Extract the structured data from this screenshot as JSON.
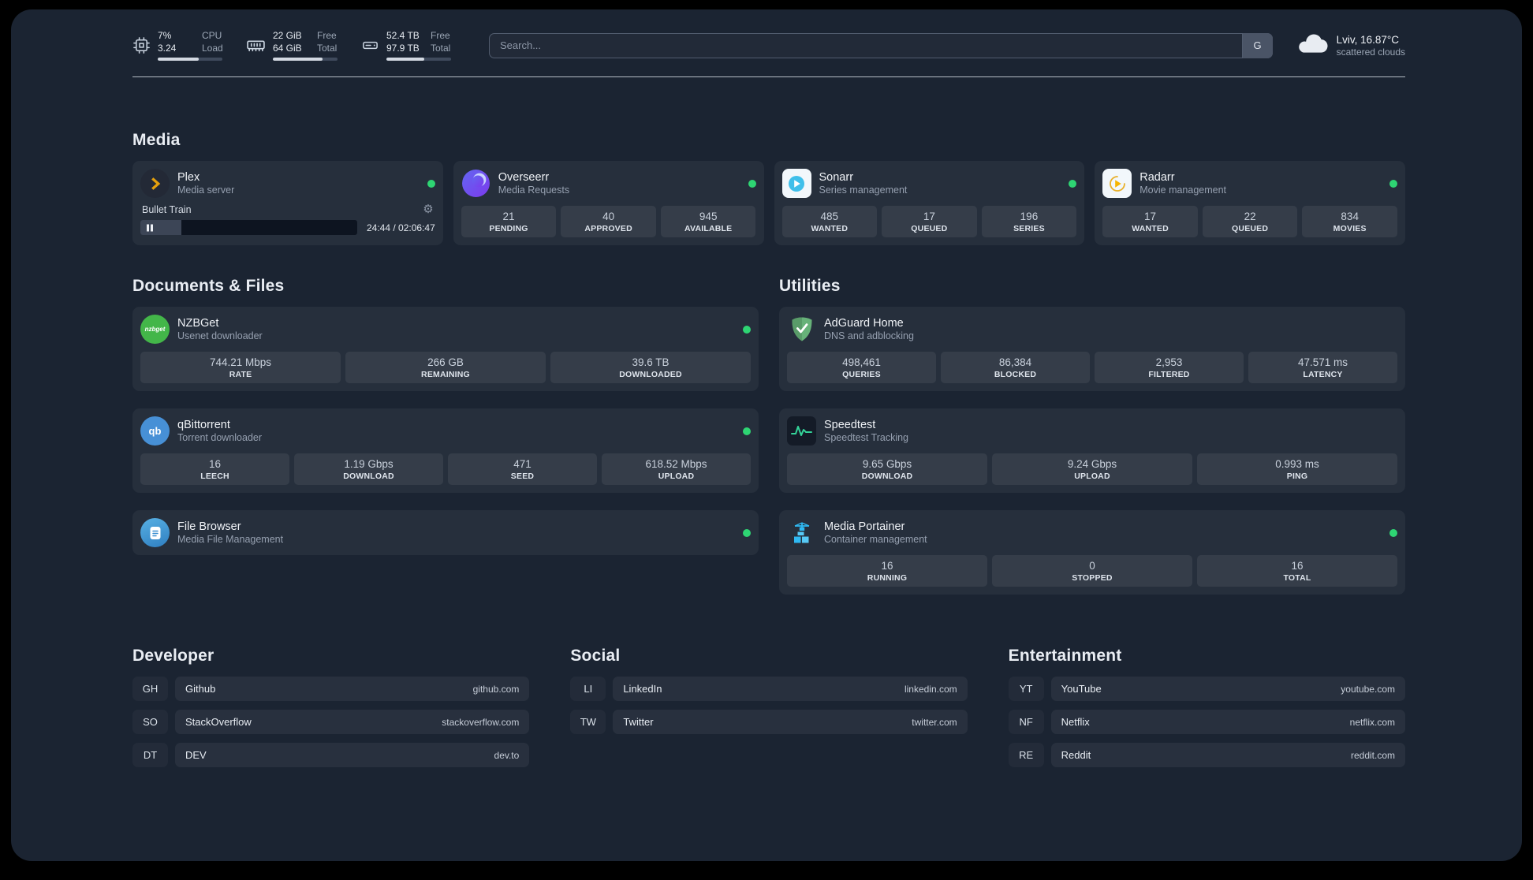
{
  "colors": {
    "status_online": "#2ed573"
  },
  "topbar": {
    "cpu": {
      "value_top": "7%",
      "value_bottom": "3.24",
      "label_top": "CPU",
      "label_bottom": "Load",
      "bar_pct": 64
    },
    "memory": {
      "value_top": "22 GiB",
      "value_bottom": "64 GiB",
      "label_top": "Free",
      "label_bottom": "Total",
      "bar_pct": 77
    },
    "disk": {
      "value_top": "52.4 TB",
      "value_bottom": "97.9 TB",
      "label_top": "Free",
      "label_bottom": "Total",
      "bar_pct": 58
    },
    "search": {
      "placeholder": "Search...",
      "button_label": "G"
    },
    "weather": {
      "location": "Lviv, 16.87°C",
      "condition": "scattered clouds"
    }
  },
  "groups": {
    "media": {
      "title": "Media"
    },
    "documents": {
      "title": "Documents & Files"
    },
    "utilities": {
      "title": "Utilities"
    }
  },
  "services": {
    "plex": {
      "name": "Plex",
      "subtitle": "Media server",
      "player": {
        "track": "Bullet Train",
        "time": "24:44 / 02:06:47",
        "progress_pct": 19
      }
    },
    "overseerr": {
      "name": "Overseerr",
      "subtitle": "Media Requests",
      "stats": [
        {
          "value": "21",
          "label": "PENDING"
        },
        {
          "value": "40",
          "label": "APPROVED"
        },
        {
          "value": "945",
          "label": "AVAILABLE"
        }
      ]
    },
    "sonarr": {
      "name": "Sonarr",
      "subtitle": "Series management",
      "stats": [
        {
          "value": "485",
          "label": "WANTED"
        },
        {
          "value": "17",
          "label": "QUEUED"
        },
        {
          "value": "196",
          "label": "SERIES"
        }
      ]
    },
    "radarr": {
      "name": "Radarr",
      "subtitle": "Movie management",
      "stats": [
        {
          "value": "17",
          "label": "WANTED"
        },
        {
          "value": "22",
          "label": "QUEUED"
        },
        {
          "value": "834",
          "label": "MOVIES"
        }
      ]
    },
    "nzbget": {
      "name": "NZBGet",
      "subtitle": "Usenet downloader",
      "icon_text": "nzbget",
      "stats": [
        {
          "value": "744.21 Mbps",
          "label": "RATE"
        },
        {
          "value": "266 GB",
          "label": "REMAINING"
        },
        {
          "value": "39.6 TB",
          "label": "DOWNLOADED"
        }
      ]
    },
    "qbittorrent": {
      "name": "qBittorrent",
      "subtitle": "Torrent downloader",
      "icon_text": "qb",
      "stats": [
        {
          "value": "16",
          "label": "LEECH"
        },
        {
          "value": "1.19 Gbps",
          "label": "DOWNLOAD"
        },
        {
          "value": "471",
          "label": "SEED"
        },
        {
          "value": "618.52 Mbps",
          "label": "UPLOAD"
        }
      ]
    },
    "filebrowser": {
      "name": "File Browser",
      "subtitle": "Media File Management"
    },
    "adguard": {
      "name": "AdGuard Home",
      "subtitle": "DNS and adblocking",
      "stats": [
        {
          "value": "498,461",
          "label": "QUERIES"
        },
        {
          "value": "86,384",
          "label": "BLOCKED"
        },
        {
          "value": "2,953",
          "label": "FILTERED"
        },
        {
          "value": "47.571 ms",
          "label": "LATENCY"
        }
      ]
    },
    "speedtest": {
      "name": "Speedtest",
      "subtitle": "Speedtest Tracking",
      "stats": [
        {
          "value": "9.65 Gbps",
          "label": "DOWNLOAD"
        },
        {
          "value": "9.24 Gbps",
          "label": "UPLOAD"
        },
        {
          "value": "0.993 ms",
          "label": "PING"
        }
      ]
    },
    "portainer": {
      "name": "Media Portainer",
      "subtitle": "Container management",
      "stats": [
        {
          "value": "16",
          "label": "RUNNING"
        },
        {
          "value": "0",
          "label": "STOPPED"
        },
        {
          "value": "16",
          "label": "TOTAL"
        }
      ]
    }
  },
  "bookmarks": {
    "developer": {
      "title": "Developer",
      "items": [
        {
          "abbr": "GH",
          "name": "Github",
          "url": "github.com"
        },
        {
          "abbr": "SO",
          "name": "StackOverflow",
          "url": "stackoverflow.com"
        },
        {
          "abbr": "DT",
          "name": "DEV",
          "url": "dev.to"
        }
      ]
    },
    "social": {
      "title": "Social",
      "items": [
        {
          "abbr": "LI",
          "name": "LinkedIn",
          "url": "linkedin.com"
        },
        {
          "abbr": "TW",
          "name": "Twitter",
          "url": "twitter.com"
        }
      ]
    },
    "entertainment": {
      "title": "Entertainment",
      "items": [
        {
          "abbr": "YT",
          "name": "YouTube",
          "url": "youtube.com"
        },
        {
          "abbr": "NF",
          "name": "Netflix",
          "url": "netflix.com"
        },
        {
          "abbr": "RE",
          "name": "Reddit",
          "url": "reddit.com"
        }
      ]
    }
  }
}
